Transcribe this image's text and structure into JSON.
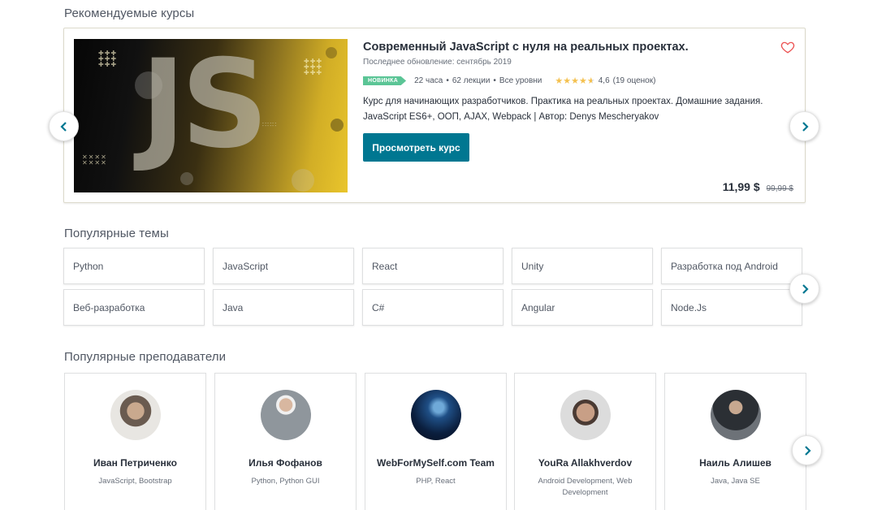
{
  "sections": {
    "recommended_title": "Рекомендуемые курсы",
    "topics_title": "Популярные темы",
    "instructors_title": "Популярные преподаватели"
  },
  "featured_course": {
    "image_text": "JS",
    "title": "Современный JavaScript с нуля на реальных проектах.",
    "updated": "Последнее обновление: сентябрь 2019",
    "badge": "Новинка",
    "hours": "22 часа",
    "lectures": "62 лекции",
    "level": "Все уровни",
    "rating_value": 4.6,
    "rating": "4,6",
    "rating_count": "(19 оценок)",
    "description": "Курс для начинающих разработчиков. Практика на реальных проектах. Домашние задания. JavaScript ES6+, ООП, AJAX, Webpack | Автор: Denys Mescheryakov",
    "button_label": "Просмотреть курс",
    "price": "11,99 $",
    "old_price": "99,99 $"
  },
  "topics": [
    "Python",
    "JavaScript",
    "React",
    "Unity",
    "Разработка под Android",
    "Веб-разработка",
    "Java",
    "C#",
    "Angular",
    "Node.Js"
  ],
  "instructors": [
    {
      "name": "Иван Петриченко",
      "topics": "JavaScript, Bootstrap",
      "avatar_color": "#5b5651"
    },
    {
      "name": "Илья Фофанов",
      "topics": "Python, Python GUI",
      "avatar_color": "#9aa2a8"
    },
    {
      "name": "WebForMySelf.com Team",
      "topics": "PHP, React",
      "avatar_color": "#0b1f3f"
    },
    {
      "name": "YouRa Allakhverdov",
      "topics": "Android Development, Web Development",
      "avatar_color": "#8a7466"
    },
    {
      "name": "Наиль Алишев",
      "topics": "Java, Java SE",
      "avatar_color": "#3b4147"
    }
  ],
  "colors": {
    "primary": "#007791",
    "badge": "#5bc596",
    "star": "#f4c150",
    "heart": "#ec5252"
  },
  "icons": [
    "chevron-left-icon",
    "chevron-right-icon",
    "heart-icon",
    "star-icon"
  ]
}
